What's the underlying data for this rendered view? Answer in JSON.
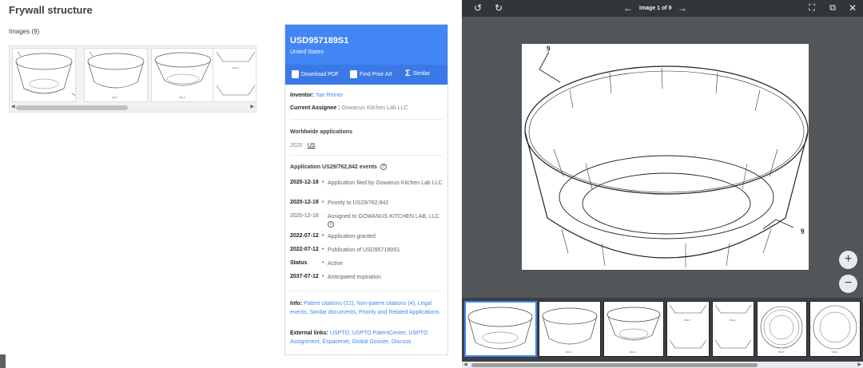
{
  "page": {
    "title": "Frywall structure",
    "images_label": "Images (9)"
  },
  "card": {
    "pub_number": "USD957189S1",
    "country": "United States",
    "actions": {
      "download_pdf": "Download PDF",
      "find_prior_art": "Find Prior Art",
      "similar": "Similar"
    },
    "inventor_label": "Inventor:",
    "inventor": "Yair Reiner",
    "assignee_label": "Current Assignee :",
    "assignee": "Gowanus Kitchen Lab LLC",
    "worldwide_title": "Worldwide applications",
    "worldwide_year": "2020",
    "worldwide_sep": "·",
    "worldwide_country": "US",
    "events_title": "Application US29/762,842 events",
    "events": [
      {
        "date": "2020-12-18",
        "text": "Application filed by Gowanus Kitchen Lab LLC",
        "bold": true
      },
      {
        "date": "2020-12-18",
        "text": "Priority to US29/762,842",
        "bold": true
      },
      {
        "date": "2020-12-18",
        "text": "Assigned to GOWANUS KITCHEN LAB, LLC",
        "bold": false
      },
      {
        "date": "2022-07-12",
        "text": "Application granted",
        "bold": true
      },
      {
        "date": "2022-07-12",
        "text": "Publication of USD957189S1",
        "bold": true
      },
      {
        "date": "Status",
        "text": "Active",
        "bold": true
      },
      {
        "date": "2037-07-12",
        "text": "Anticipated expiration",
        "bold": true
      }
    ],
    "info_label": "Info:",
    "info_links": "Patent citations (21), Non-patent citations (4), Legal events, Similar documents, Priority and Related Applications",
    "external_label": "External links:",
    "external_links": "USPTO, USPTO PatentCenter, USPTO Assignment, Espacenet, Global Dossier, Discuss"
  },
  "viewer": {
    "counter": "Image 1 of 9",
    "ref_label_top": "9",
    "ref_label_bottom": "9",
    "zoom_in": "+",
    "zoom_out": "−"
  },
  "thumb_labels": [
    "FIG.1",
    "FIG.2",
    "FIG.3",
    "FIG.4",
    "FIG.5",
    "FIG.6"
  ],
  "colors": {
    "accent": "#4285f4",
    "viewer_bg": "#525659",
    "toolbar_bg": "#323639"
  },
  "icons": [
    "rotate-left-icon",
    "rotate-right-icon",
    "arrow-left-icon",
    "arrow-right-icon",
    "fullscreen-icon",
    "open-external-icon",
    "close-icon",
    "pdf-icon",
    "prior-art-icon",
    "sigma-icon",
    "help-icon"
  ]
}
